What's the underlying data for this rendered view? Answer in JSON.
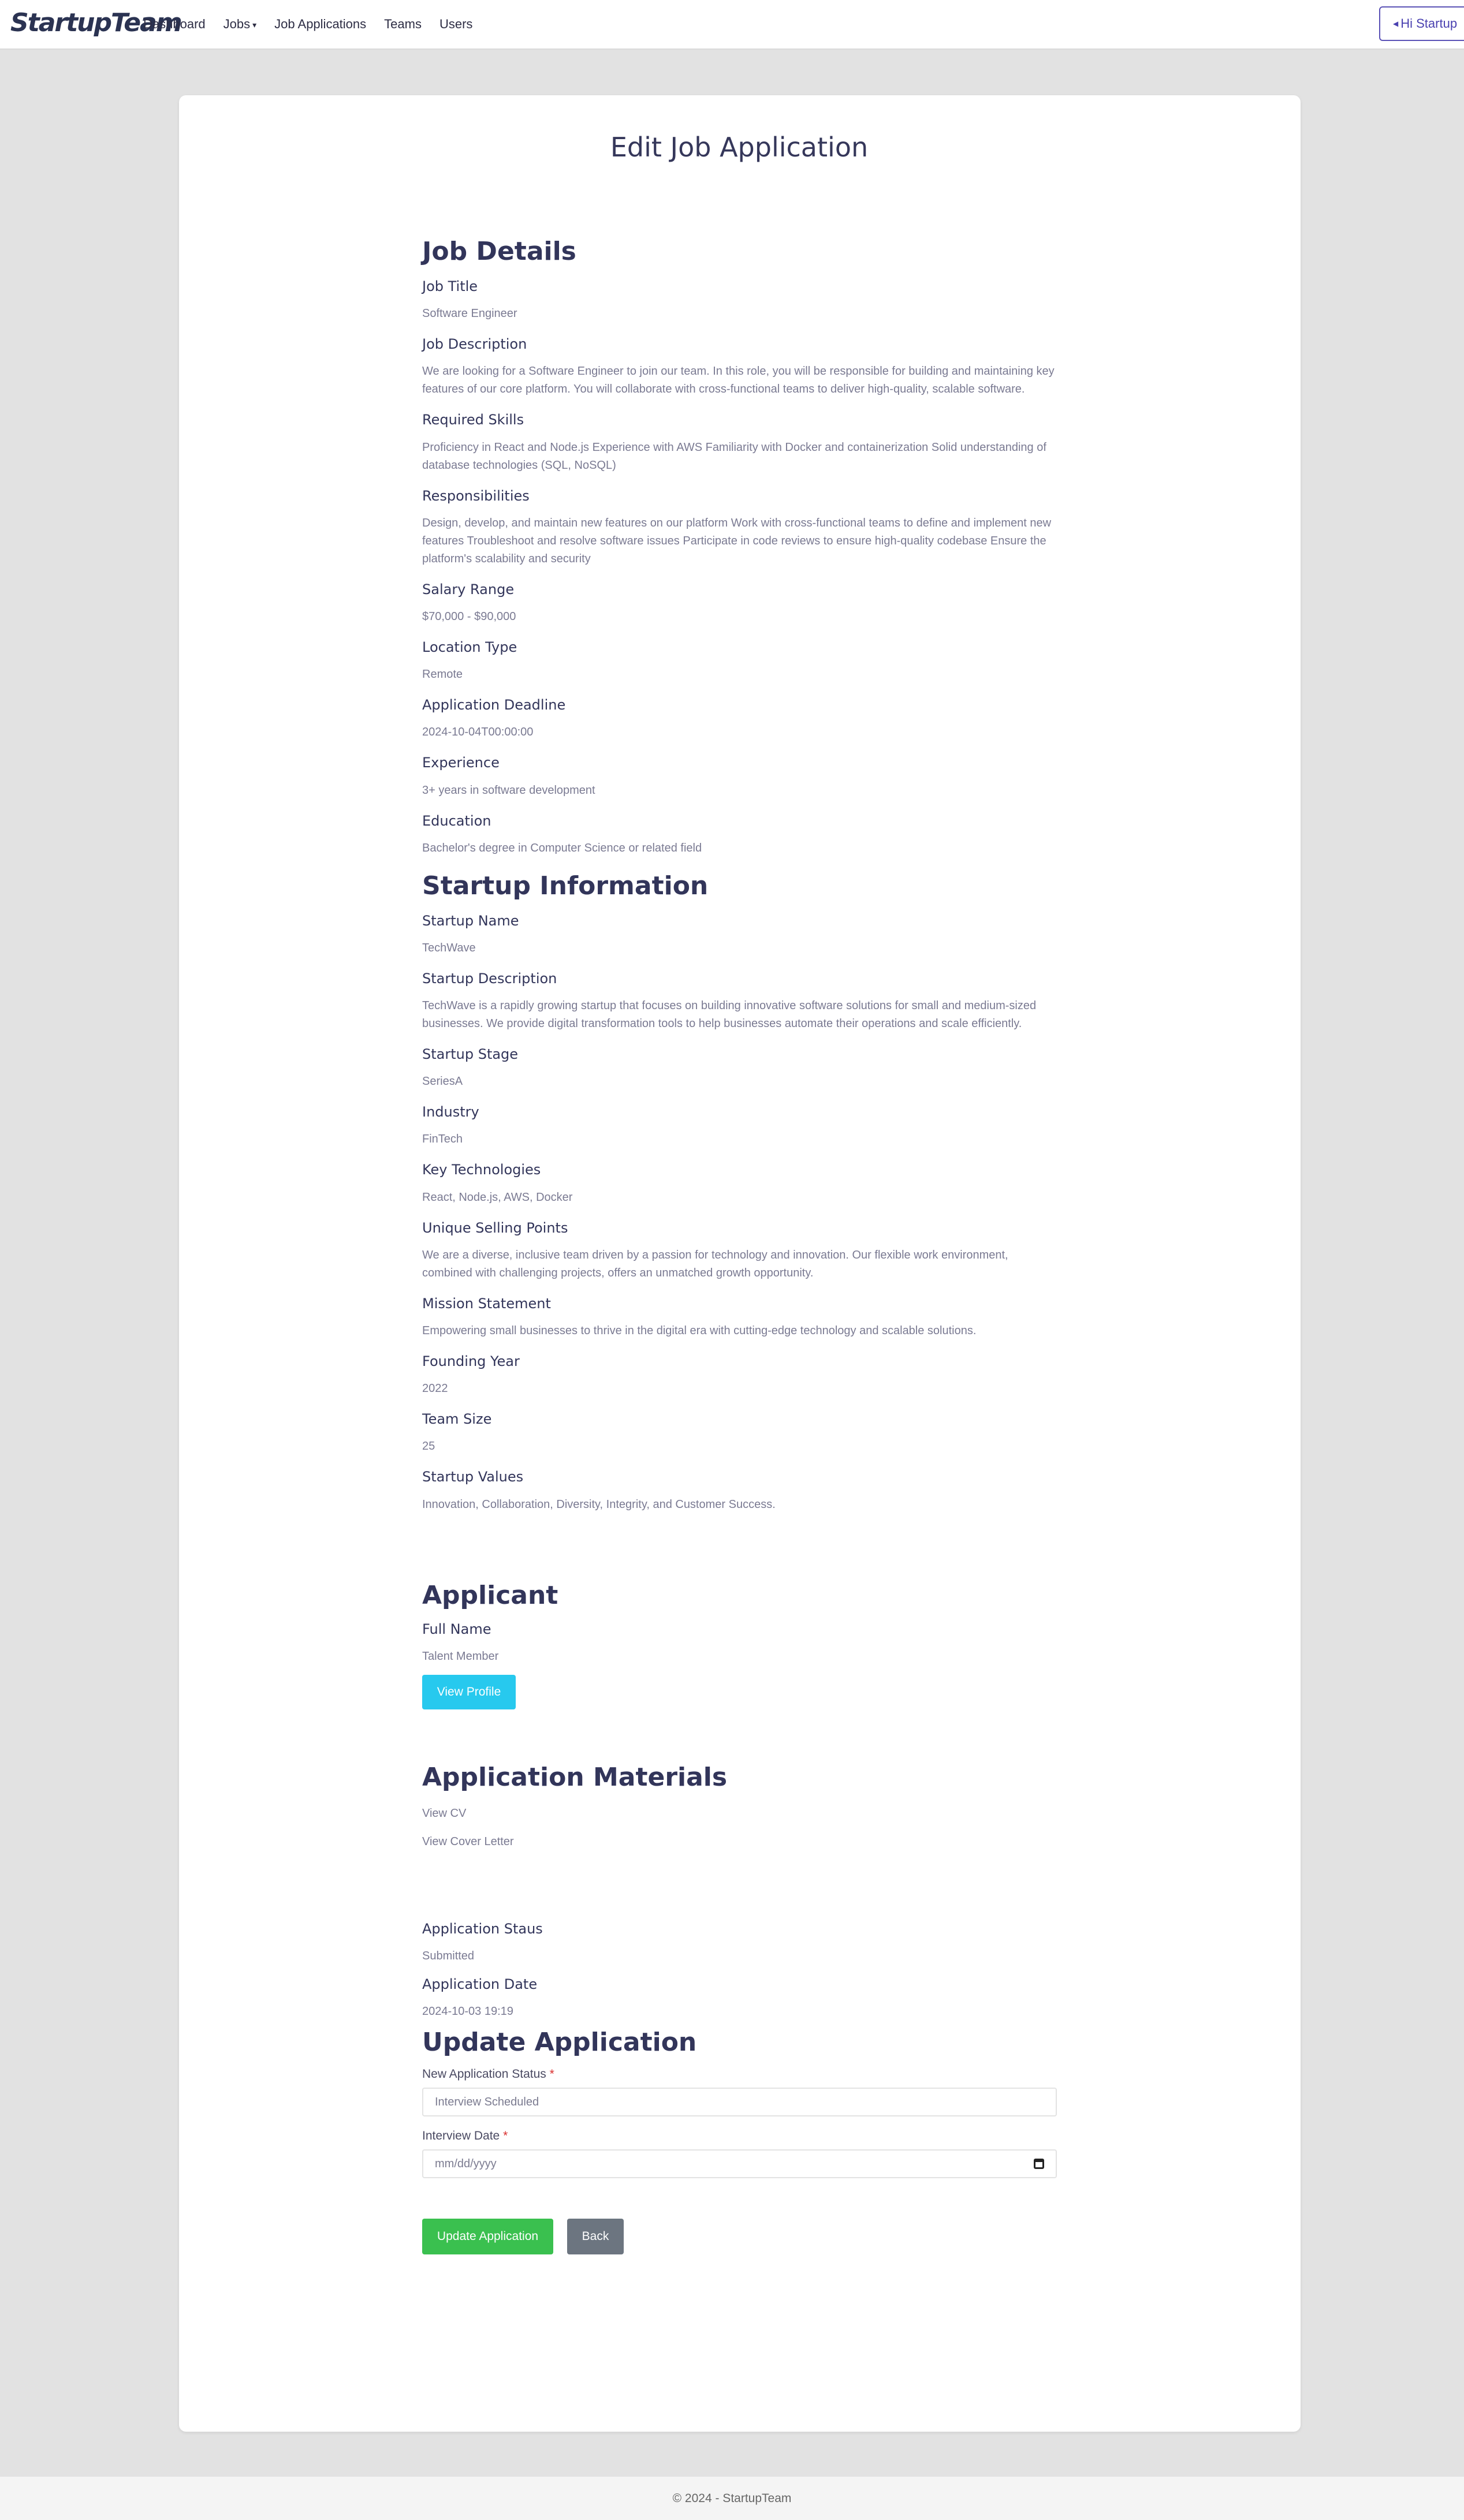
{
  "nav": {
    "brand": "StartupTeam",
    "links": [
      "Dashboard",
      "Jobs",
      "Job Applications",
      "Teams",
      "Users"
    ],
    "user_button": "Hi Startup"
  },
  "page_title": "Edit Job Application",
  "job_details": {
    "heading": "Job Details",
    "fields": [
      {
        "label": "Job Title",
        "value": "Software Engineer"
      },
      {
        "label": "Job Description",
        "value": "We are looking for a Software Engineer to join our team. In this role, you will be responsible for building and maintaining key features of our core platform. You will collaborate with cross-functional teams to deliver high-quality, scalable software."
      },
      {
        "label": "Required Skills",
        "value": "Proficiency in React and Node.js Experience with AWS Familiarity with Docker and containerization Solid understanding of database technologies (SQL, NoSQL)"
      },
      {
        "label": "Responsibilities",
        "value": "Design, develop, and maintain new features on our platform Work with cross-functional teams to define and implement new features Troubleshoot and resolve software issues Participate in code reviews to ensure high-quality codebase Ensure the platform's scalability and security"
      },
      {
        "label": "Salary Range",
        "value": "$70,000 - $90,000"
      },
      {
        "label": "Location Type",
        "value": "Remote"
      },
      {
        "label": "Application Deadline",
        "value": "2024-10-04T00:00:00"
      },
      {
        "label": "Experience",
        "value": "3+ years in software development"
      },
      {
        "label": "Education",
        "value": "Bachelor's degree in Computer Science or related field"
      }
    ]
  },
  "startup_info": {
    "heading": "Startup Information",
    "fields": [
      {
        "label": "Startup Name",
        "value": "TechWave"
      },
      {
        "label": "Startup Description",
        "value": "TechWave is a rapidly growing startup that focuses on building innovative software solutions for small and medium-sized businesses. We provide digital transformation tools to help businesses automate their operations and scale efficiently."
      },
      {
        "label": "Startup Stage",
        "value": "SeriesA"
      },
      {
        "label": "Industry",
        "value": "FinTech"
      },
      {
        "label": "Key Technologies",
        "value": "React, Node.js, AWS, Docker"
      },
      {
        "label": "Unique Selling Points",
        "value": "We are a diverse, inclusive team driven by a passion for technology and innovation. Our flexible work environment, combined with challenging projects, offers an unmatched growth opportunity."
      },
      {
        "label": "Mission Statement",
        "value": "Empowering small businesses to thrive in the digital era with cutting-edge technology and scalable solutions."
      },
      {
        "label": "Founding Year",
        "value": "2022"
      },
      {
        "label": "Team Size",
        "value": "25"
      },
      {
        "label": "Startup Values",
        "value": "Innovation, Collaboration, Diversity, Integrity, and Customer Success."
      }
    ]
  },
  "applicant": {
    "heading": "Applicant",
    "full_name_label": "Full Name",
    "full_name": "Talent Member",
    "view_profile": "View Profile"
  },
  "materials": {
    "heading": "Application Materials",
    "cv_link": "View CV",
    "cover_link": "View Cover Letter"
  },
  "application_info": {
    "status_label": "Application Staus",
    "status": "Submitted",
    "date_label": "Application Date",
    "date": "2024-10-03 19:19"
  },
  "update_form": {
    "heading": "Update Application",
    "status_label": "New Application Status",
    "status_value": "Interview Scheduled",
    "date_label": "Interview Date",
    "date_placeholder": "mm/dd/yyyy",
    "required_mark": "*",
    "submit_label": "Update Application",
    "back_label": "Back"
  },
  "footer": "© 2024 - StartupTeam"
}
